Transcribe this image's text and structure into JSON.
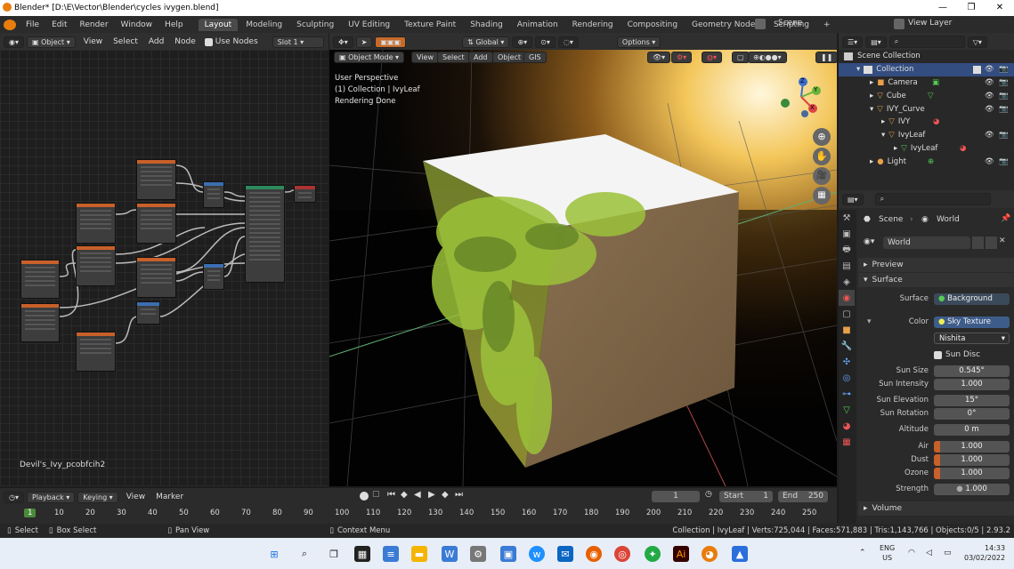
{
  "window": {
    "title": "Blender* [D:\\E\\Vector\\Blender\\cycles ivygen.blend]",
    "minimize": "—",
    "maximize": "❐",
    "close": "✕"
  },
  "menu": [
    "File",
    "Edit",
    "Render",
    "Window",
    "Help"
  ],
  "workspaces": [
    "Layout",
    "Modeling",
    "Sculpting",
    "UV Editing",
    "Texture Paint",
    "Shading",
    "Animation",
    "Rendering",
    "Compositing",
    "Geometry Nodes",
    "Scripting"
  ],
  "scene": {
    "label": "Scene",
    "view_layer": "View Layer"
  },
  "node_editor": {
    "object_mode": "Object",
    "menus": [
      "View",
      "Select",
      "Add",
      "Node"
    ],
    "use_nodes": "Use Nodes",
    "slot": "Slot 1",
    "material_name": "Devil's_Ivy_pcobfcih2"
  },
  "viewport": {
    "mode": "Object Mode",
    "menus": [
      "View",
      "Select",
      "Add",
      "Object",
      "GIS"
    ],
    "orientation": "Global",
    "options": "Options",
    "overlay_lines": [
      "User Perspective",
      "(1) Collection | IvyLeaf",
      "Rendering Done"
    ],
    "gizmo": {
      "z": "Z",
      "y": "Y",
      "x": "X"
    }
  },
  "outliner": {
    "root": "Scene Collection",
    "items": [
      {
        "name": "Collection",
        "icon": "collection-icon",
        "depth": 0
      },
      {
        "name": "Camera",
        "icon": "camera-icon",
        "depth": 1
      },
      {
        "name": "Cube",
        "icon": "mesh-icon",
        "depth": 1
      },
      {
        "name": "IVY_Curve",
        "icon": "curve-icon",
        "depth": 1
      },
      {
        "name": "IVY",
        "icon": "mesh-icon",
        "depth": 2
      },
      {
        "name": "IvyLeaf",
        "icon": "mesh-icon",
        "depth": 2
      },
      {
        "name": "IvyLeaf",
        "icon": "mesh-data-icon",
        "depth": 3
      },
      {
        "name": "Light",
        "icon": "light-icon",
        "depth": 1
      }
    ]
  },
  "properties": {
    "breadcrumb_scene": "Scene",
    "breadcrumb_world": "World",
    "world_name": "World",
    "preview": "Preview",
    "surface_panel": "Surface",
    "surface_label": "Surface",
    "surface_value": "Background",
    "color_label": "Color",
    "color_value": "Sky Texture",
    "sky_type": "Nishita",
    "sun_disc": "Sun Disc",
    "fields": [
      {
        "label": "Sun Size",
        "value": "0.545°"
      },
      {
        "label": "Sun Intensity",
        "value": "1.000"
      },
      {
        "label": "Sun Elevation",
        "value": "15°"
      },
      {
        "label": "Sun Rotation",
        "value": "0°"
      },
      {
        "label": "Altitude",
        "value": "0 m"
      },
      {
        "label": "Air",
        "value": "1.000"
      },
      {
        "label": "Dust",
        "value": "1.000"
      },
      {
        "label": "Ozone",
        "value": "1.000"
      },
      {
        "label": "Strength",
        "value": "1.000"
      }
    ],
    "volume": "Volume"
  },
  "timeline": {
    "playback": "Playback",
    "keying": "Keying",
    "view": "View",
    "marker": "Marker",
    "current_frame": "1",
    "start_label": "Start",
    "start": "1",
    "end_label": "End",
    "end": "250",
    "ticks": [
      "1",
      "10",
      "20",
      "30",
      "40",
      "50",
      "60",
      "70",
      "80",
      "90",
      "100",
      "110",
      "120",
      "130",
      "140",
      "150",
      "160",
      "170",
      "180",
      "190",
      "200",
      "210",
      "220",
      "230",
      "240",
      "250"
    ]
  },
  "statusbar": {
    "select": "Select",
    "box_select": "Box Select",
    "pan_view": "Pan View",
    "context_menu": "Context Menu",
    "stats": "Collection | IvyLeaf | Verts:725,044 | Faces:571,883 | Tris:1,143,766 | Objects:0/5 | 2.93.2"
  },
  "taskbar": {
    "lang": "ENG",
    "region": "US",
    "time": "14:33",
    "date": "03/02/2022"
  }
}
